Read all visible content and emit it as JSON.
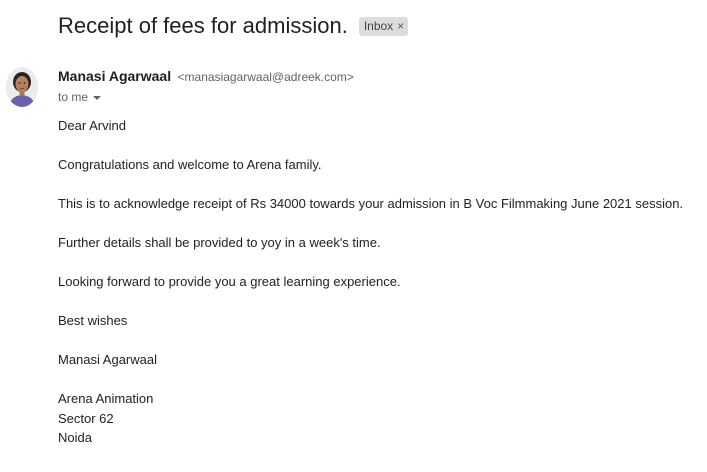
{
  "email": {
    "subject": "Receipt of fees for admission.",
    "label": {
      "text": "Inbox",
      "close": "×"
    },
    "sender": {
      "name": "Manasi Agarwaal",
      "email": "<manasiagarwaal@adreek.com>"
    },
    "recipient": "to me",
    "icons": {
      "recipient_toggle": "chevron-down-icon",
      "label_remove": "close-icon"
    },
    "colors": {
      "label_bg": "#dddddd",
      "secondary_text": "#5f6368"
    },
    "body": {
      "greeting": "Dear Arvind",
      "paragraphs": [
        "Congratulations and welcome to Arena family.",
        "This is to acknowledge receipt of Rs 34000 towards your admission  in B Voc Filmmaking June 2021 session.",
        "Further details shall be provided to yoy in a week's time.",
        "Looking forward to provide you a great learning experience.",
        "Best wishes",
        "Manasi Agarwaal"
      ],
      "signature": [
        "Arena Animation",
        "Sector 62",
        "Noida"
      ]
    }
  }
}
